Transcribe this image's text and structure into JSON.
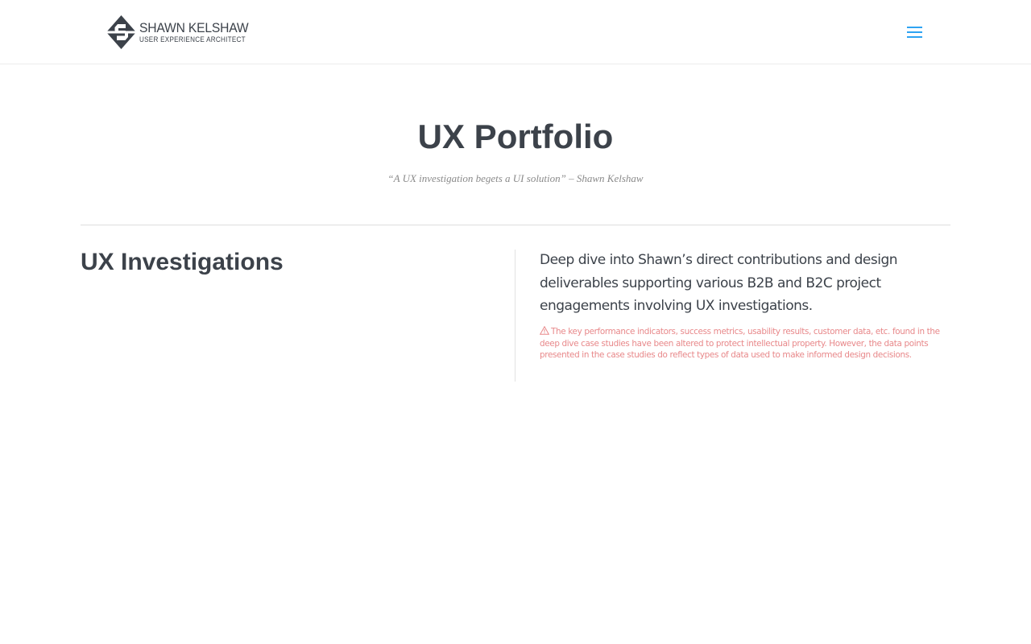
{
  "header": {
    "logo": {
      "name": "SHAWN KELSHAW",
      "tagline": "USER EXPERIENCE ARCHITECT",
      "icon": "diamond-s-logo-icon",
      "color": "#3c424a"
    },
    "menu": {
      "icon": "hamburger-menu-icon",
      "color": "#2ea3f2"
    }
  },
  "hero": {
    "title": "UX Portfolio",
    "quote": "“A UX investigation begets a UI solution” – Shawn Kelshaw"
  },
  "section": {
    "heading": "UX Investigations",
    "description": "Deep dive into Shawn’s direct contributions and design deliverables supporting various B2B and B2C project engagements involving UX investigations.",
    "disclaimer": {
      "icon": "warning-icon",
      "icon_glyph": "⚠",
      "text": "The key performance indicators, success metrics, usability results, customer data, etc. found in the deep dive case studies have been altered to protect intellectual property. However, the data points presented in the case studies do reflect types of data used to make informed design decisions.",
      "color": "#e8888a"
    }
  }
}
